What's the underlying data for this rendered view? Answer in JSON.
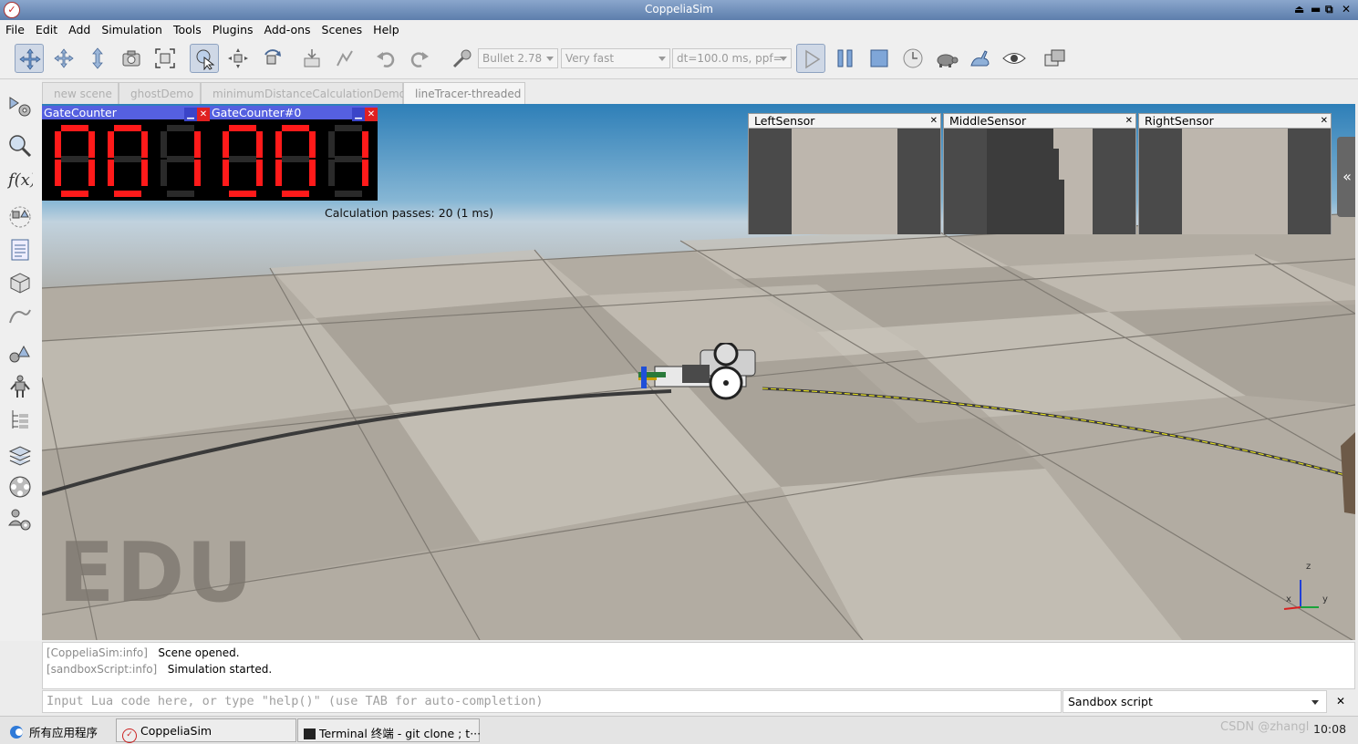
{
  "window": {
    "title": "CoppeliaSim",
    "controls": [
      "⏏",
      "▬",
      "⧉",
      "✕"
    ]
  },
  "menu": [
    "File",
    "Edit",
    "Add",
    "Simulation",
    "Tools",
    "Plugins",
    "Add-ons",
    "Scenes",
    "Help"
  ],
  "toolbar": {
    "engine": "Bullet 2.78",
    "speed": "Very fast",
    "dt": "dt=100.0 ms, ppf="
  },
  "tabs": [
    "new scene",
    "ghostDemo",
    "minimumDistanceCalculationDemo",
    "lineTracer-threaded"
  ],
  "viewport": {
    "gate_counters": [
      {
        "title": "GateCounter",
        "digits": "001"
      },
      {
        "title": "GateCounter#0",
        "digits": "001"
      }
    ],
    "calc_passes": "Calculation passes: 20 (1 ms)",
    "sensors": [
      {
        "title": "LeftSensor"
      },
      {
        "title": "MiddleSensor"
      },
      {
        "title": "RightSensor"
      }
    ],
    "watermark": "EDU",
    "axes": {
      "z": "z",
      "x": "x",
      "y": "y"
    },
    "collapse_glyph": "«"
  },
  "console": {
    "lines": [
      {
        "tag": "[CoppeliaSim:info]",
        "msg": "Scene opened."
      },
      {
        "tag": "[sandboxScript:info]",
        "msg": "Simulation started."
      }
    ],
    "input_placeholder": "Input Lua code here, or type \"help()\" (use TAB for auto-completion)",
    "script_selector": "Sandbox script",
    "close": "✕"
  },
  "taskbar": {
    "start": "所有应用程序",
    "tasks": [
      "CoppeliaSim",
      "Terminal 终端 - git clone ; t···"
    ],
    "watermark": "CSDN @zhangl",
    "clock": "10:08"
  },
  "colors": {
    "accent": "#5d7eac",
    "segment_on": "#ff1a1a",
    "segment_off": "#2a2a2a",
    "counter_header": "#5560e0"
  }
}
